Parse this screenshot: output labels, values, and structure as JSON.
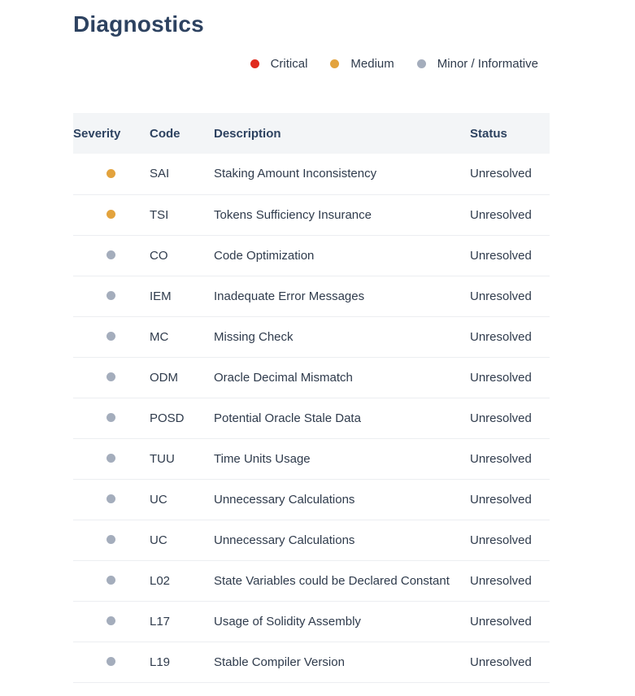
{
  "title": "Diagnostics",
  "legend": [
    {
      "label": "Critical",
      "color": "#e02b1e"
    },
    {
      "label": "Medium",
      "color": "#e3a33d"
    },
    {
      "label": "Minor / Informative",
      "color": "#a4adbc"
    }
  ],
  "table": {
    "headers": {
      "severity": "Severity",
      "code": "Code",
      "description": "Description",
      "status": "Status"
    },
    "rows": [
      {
        "severity": "medium",
        "color": "#e3a33d",
        "code": "SAI",
        "description": "Staking Amount Inconsistency",
        "status": "Unresolved"
      },
      {
        "severity": "medium",
        "color": "#e3a33d",
        "code": "TSI",
        "description": "Tokens Sufficiency Insurance",
        "status": "Unresolved"
      },
      {
        "severity": "minor",
        "color": "#a4adbc",
        "code": "CO",
        "description": "Code Optimization",
        "status": "Unresolved"
      },
      {
        "severity": "minor",
        "color": "#a4adbc",
        "code": "IEM",
        "description": "Inadequate Error Messages",
        "status": "Unresolved"
      },
      {
        "severity": "minor",
        "color": "#a4adbc",
        "code": "MC",
        "description": "Missing Check",
        "status": "Unresolved"
      },
      {
        "severity": "minor",
        "color": "#a4adbc",
        "code": "ODM",
        "description": "Oracle Decimal Mismatch",
        "status": "Unresolved"
      },
      {
        "severity": "minor",
        "color": "#a4adbc",
        "code": "POSD",
        "description": "Potential Oracle Stale Data",
        "status": "Unresolved"
      },
      {
        "severity": "minor",
        "color": "#a4adbc",
        "code": "TUU",
        "description": "Time Units Usage",
        "status": "Unresolved"
      },
      {
        "severity": "minor",
        "color": "#a4adbc",
        "code": "UC",
        "description": "Unnecessary Calculations",
        "status": "Unresolved"
      },
      {
        "severity": "minor",
        "color": "#a4adbc",
        "code": "UC",
        "description": "Unnecessary Calculations",
        "status": "Unresolved"
      },
      {
        "severity": "minor",
        "color": "#a4adbc",
        "code": "L02",
        "description": "State Variables could be Declared Constant",
        "status": "Unresolved"
      },
      {
        "severity": "minor",
        "color": "#a4adbc",
        "code": "L17",
        "description": "Usage of Solidity Assembly",
        "status": "Unresolved"
      },
      {
        "severity": "minor",
        "color": "#a4adbc",
        "code": "L19",
        "description": "Stable Compiler Version",
        "status": "Unresolved"
      }
    ]
  }
}
